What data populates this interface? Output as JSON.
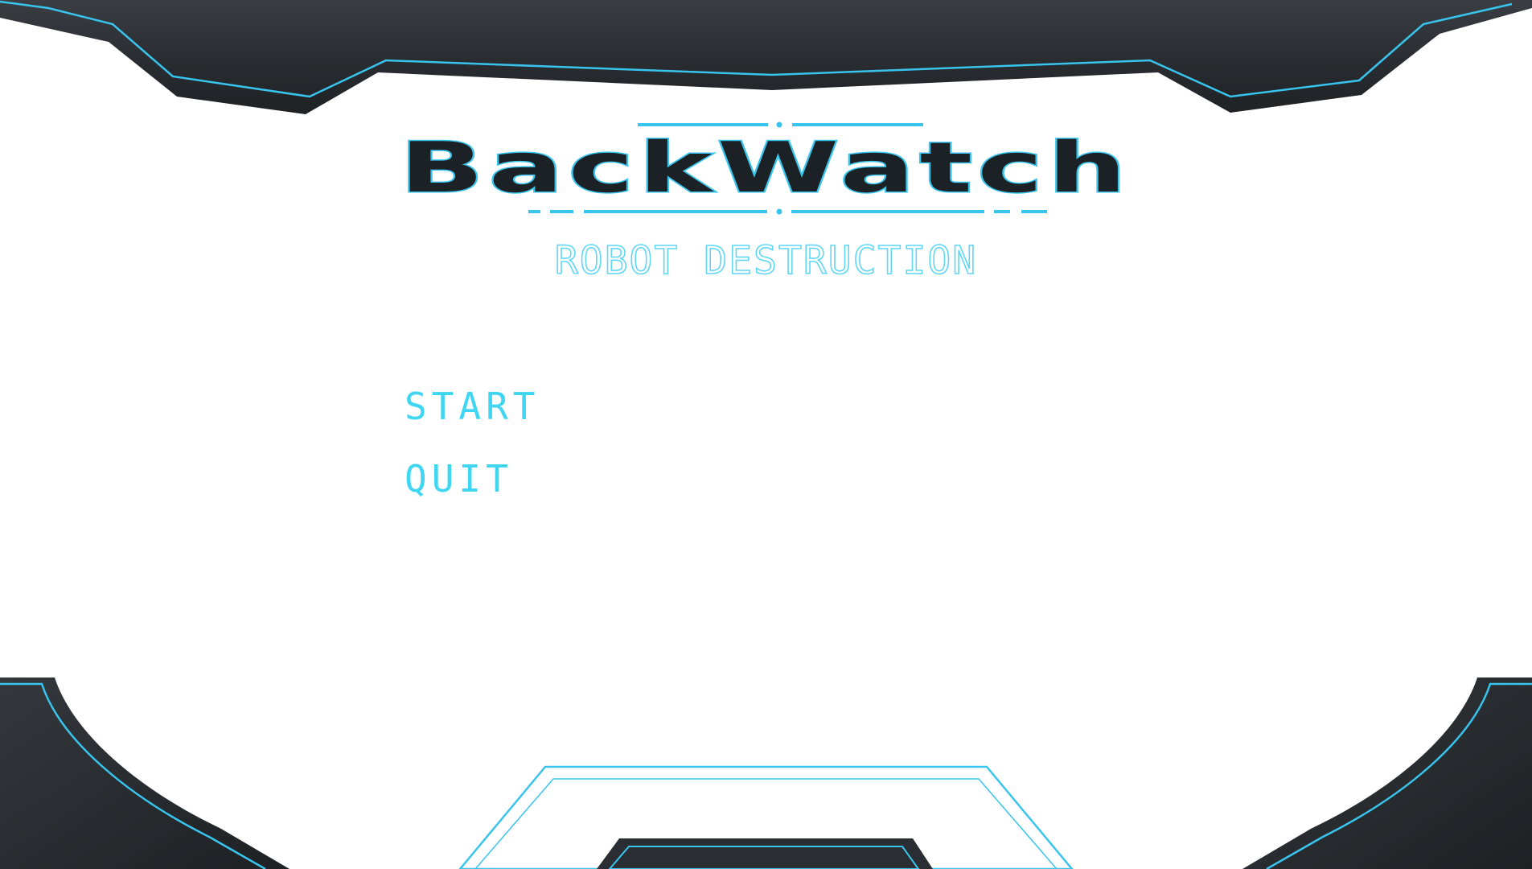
{
  "game": {
    "title": "BackWatch",
    "subtitle": "ROBOT DESTRUCTION"
  },
  "menu": {
    "items": [
      {
        "label": "START"
      },
      {
        "label": "QUIT"
      }
    ]
  },
  "colors": {
    "accent": "#39c4ee",
    "menu_text": "#3ed6f2",
    "frame_dark": "#2e3236",
    "background": "#ffffff"
  }
}
